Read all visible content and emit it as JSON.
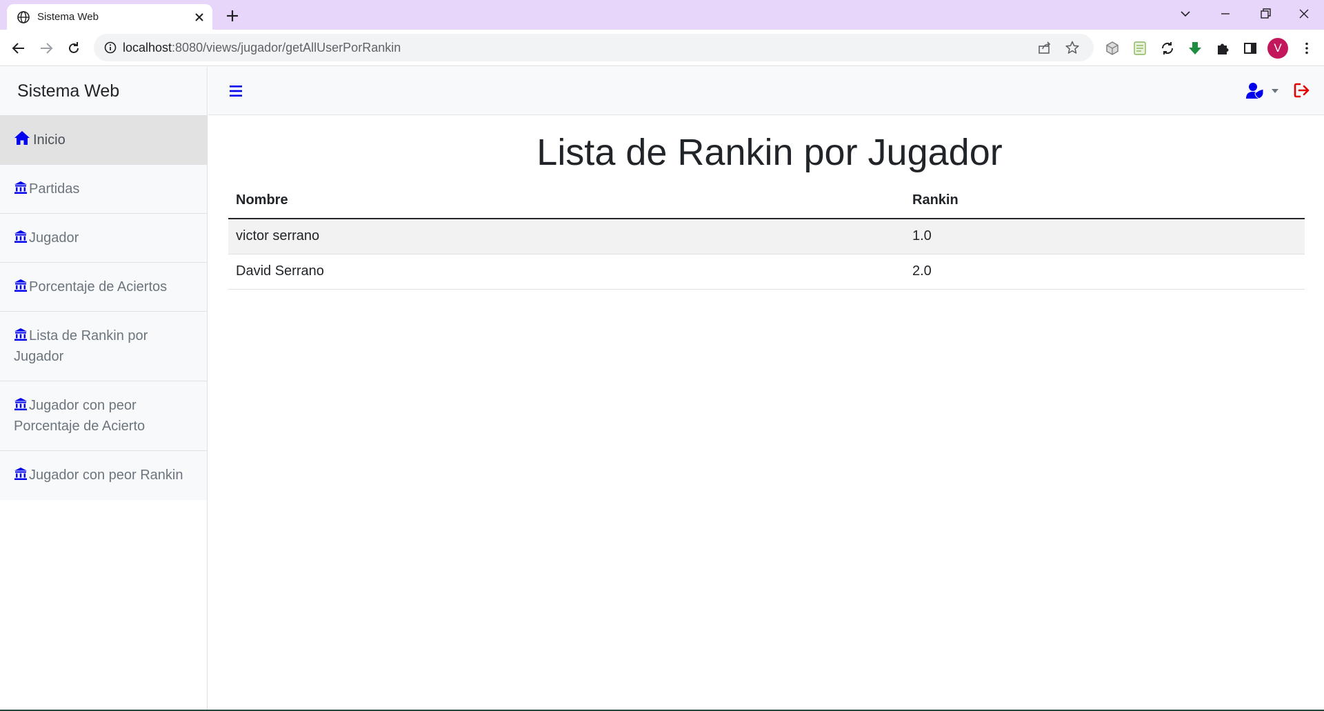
{
  "browser": {
    "tab_title": "Sistema Web",
    "url_host": "localhost",
    "url_rest": ":8080/views/jugador/getAllUserPorRankin",
    "profile_initial": "V"
  },
  "sidebar": {
    "brand": "Sistema Web",
    "items": [
      {
        "label": "Inicio",
        "icon": "home-icon",
        "active": true
      },
      {
        "label": "Partidas",
        "icon": "building-icon"
      },
      {
        "label": "Jugador",
        "icon": "building-icon"
      },
      {
        "label": "Porcentaje de Aciertos",
        "icon": "building-icon"
      },
      {
        "label": "Lista de Rankin por Jugador",
        "icon": "building-icon"
      },
      {
        "label": "Jugador con peor Porcentaje de Acierto",
        "icon": "building-icon"
      },
      {
        "label": "Jugador con peor Rankin",
        "icon": "building-icon"
      }
    ]
  },
  "main": {
    "title": "Lista de Rankin por Jugador",
    "table": {
      "headers": [
        "Nombre",
        "Rankin"
      ],
      "rows": [
        [
          "victor serrano",
          "1.0"
        ],
        [
          "David Serrano",
          "2.0"
        ]
      ]
    }
  },
  "colors": {
    "accent": "#0000ee",
    "logout": "#e00000",
    "tabbar": "#e8d6fa"
  }
}
